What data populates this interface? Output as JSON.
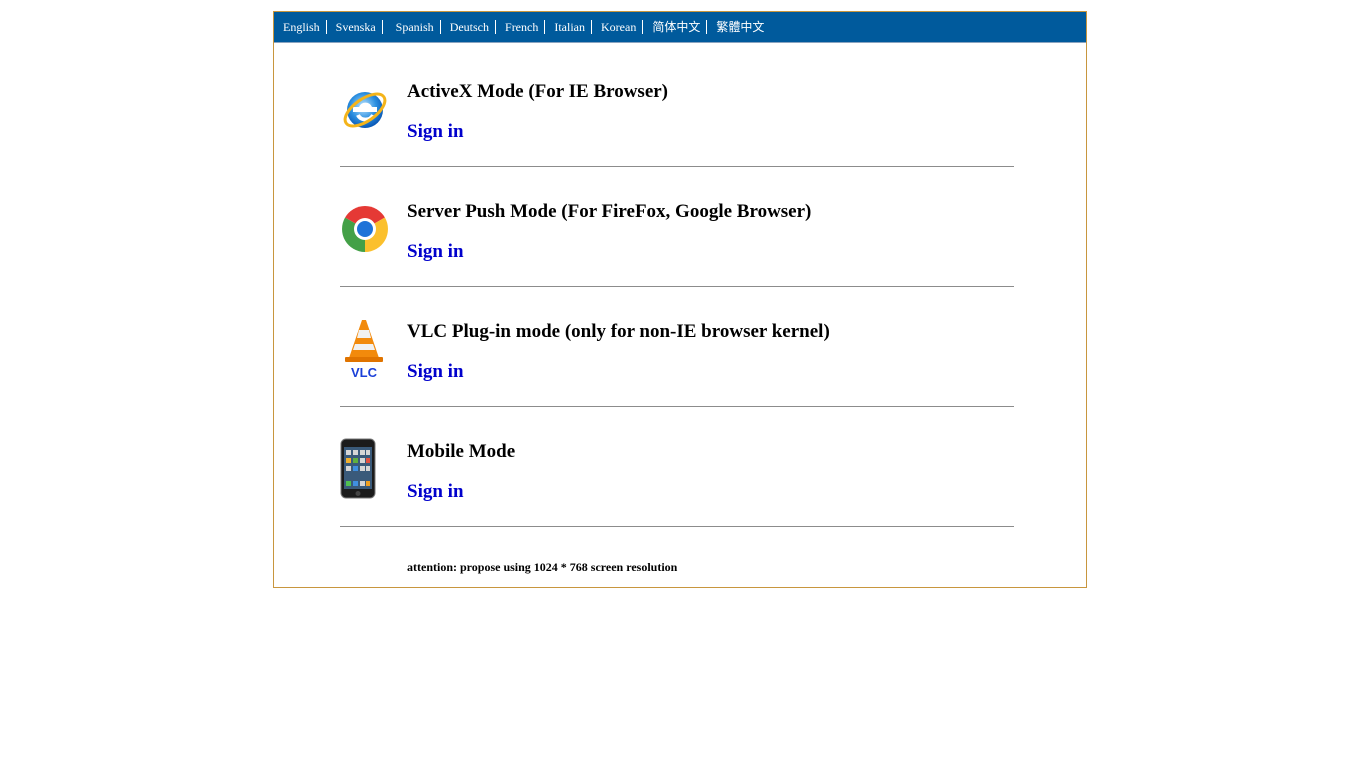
{
  "languages": [
    "English",
    "Svenska",
    "Spanish",
    "Deutsch",
    "French",
    "Italian",
    "Korean",
    "简体中文",
    "繁體中文"
  ],
  "modes": [
    {
      "title": "ActiveX Mode (For IE Browser)",
      "signin": "Sign in",
      "icon": "internet-explorer-icon"
    },
    {
      "title": "Server Push Mode (For FireFox, Google Browser)",
      "signin": "Sign in",
      "icon": "chrome-icon"
    },
    {
      "title": "VLC Plug-in mode (only for non-IE browser kernel)",
      "signin": "Sign in",
      "icon": "vlc-icon",
      "icon_label": "VLC"
    },
    {
      "title": "Mobile Mode",
      "signin": "Sign in",
      "icon": "mobile-phone-icon"
    }
  ],
  "attention": "attention: propose using 1024 * 768 screen resolution",
  "colors": {
    "header": "#005a9c",
    "border": "#c8963e",
    "link": "#0000cc",
    "rule": "#8c8c8c"
  }
}
